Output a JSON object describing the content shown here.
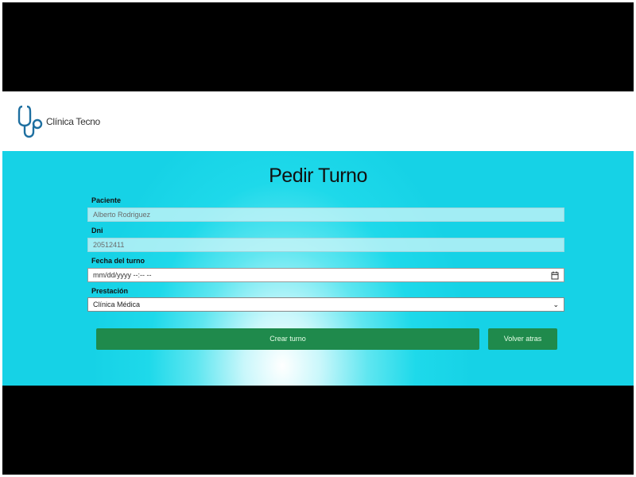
{
  "brand": {
    "name": "Clínica Tecno",
    "icon": "stethoscope-icon"
  },
  "page": {
    "title": "Pedir Turno"
  },
  "form": {
    "paciente": {
      "label": "Paciente",
      "value": "Alberto Rodriguez"
    },
    "dni": {
      "label": "Dni",
      "value": "20512411"
    },
    "fecha": {
      "label": "Fecha del turno",
      "value": "mm/dd/yyyy --:-- --"
    },
    "prestacion": {
      "label": "Prestación",
      "selected": "Clínica Médica"
    }
  },
  "buttons": {
    "create": "Crear turno",
    "back": "Volver atras"
  },
  "colors": {
    "primary_button": "#1f8a4c",
    "background": "#16d2e6",
    "brand": "#1e6fa0"
  }
}
